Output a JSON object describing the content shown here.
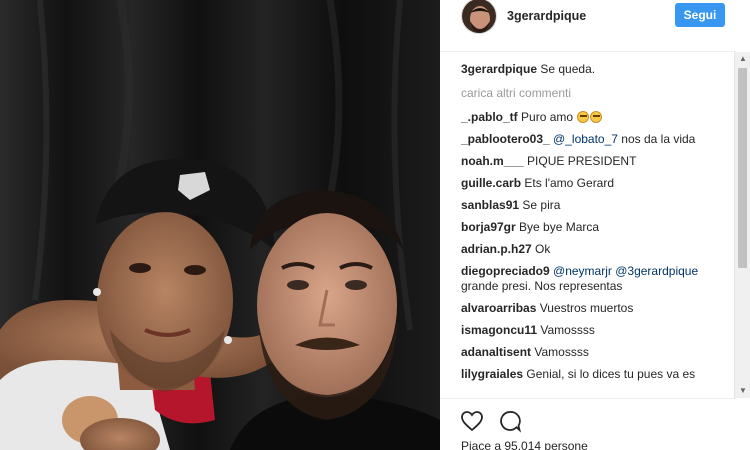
{
  "post": {
    "username": "3gerardpique",
    "follow_label": "Segui",
    "likes_text": "Piace a 95.014 persone"
  },
  "caption": {
    "user": "3gerardpique",
    "text": "Se queda."
  },
  "load_more_label": "carica altri commenti",
  "comments": [
    {
      "user": "_.pablo_tf",
      "mention": "",
      "text": "Puro amo"
    },
    {
      "user": "_pablootero03_",
      "mention": "@_lobato_7",
      "text": "nos da la vida"
    },
    {
      "user": "noah.m___",
      "mention": "",
      "text": "PIQUE PRESIDENT"
    },
    {
      "user": "guille.carb",
      "mention": "",
      "text": "Ets l'amo Gerard"
    },
    {
      "user": "sanblas91",
      "mention": "",
      "text": "Se pira"
    },
    {
      "user": "borja97gr",
      "mention": "",
      "text": "Bye bye Marca"
    },
    {
      "user": "adrian.p.h27",
      "mention": "",
      "text": "Ok"
    },
    {
      "user": "diegopreciado9",
      "mention": "@neymarjr @3gerardpique",
      "text": "grande presi. Nos representas"
    },
    {
      "user": "alvaroarribas",
      "mention": "",
      "text": "Vuestros muertos"
    },
    {
      "user": "ismagoncu11",
      "mention": "",
      "text": "Vamossss"
    },
    {
      "user": "adanaltisent",
      "mention": "",
      "text": "Vamossss"
    },
    {
      "user": "lilygraiales",
      "mention": "",
      "text": "Genial, si lo dices tu pues va es"
    }
  ],
  "icons": {
    "like": "heart-icon",
    "comment": "comment-bubble-icon",
    "scroll_up": "scroll-up-arrow",
    "scroll_down": "scroll-down-arrow"
  },
  "colors": {
    "follow_button": "#3897f0",
    "mention": "#003569",
    "muted": "#999999"
  }
}
